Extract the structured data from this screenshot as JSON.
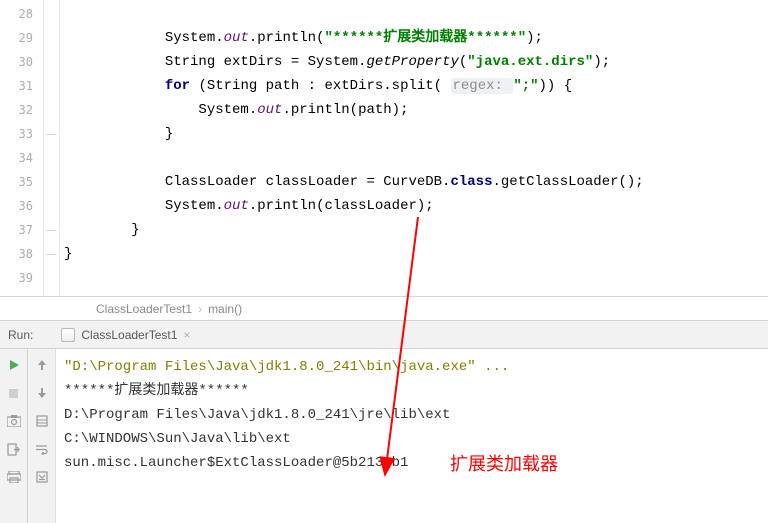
{
  "editor": {
    "lines": [
      {
        "num": 28,
        "fold": "",
        "tokens": []
      },
      {
        "num": 29,
        "fold": "",
        "tokens": [
          {
            "t": "plain",
            "v": "            System."
          },
          {
            "t": "field",
            "v": "out"
          },
          {
            "t": "plain",
            "v": ".println("
          },
          {
            "t": "str",
            "v": "\"******扩展类加载器******\""
          },
          {
            "t": "plain",
            "v": ");"
          }
        ]
      },
      {
        "num": 30,
        "fold": "",
        "tokens": [
          {
            "t": "plain",
            "v": "            String extDirs = System."
          },
          {
            "t": "method-it",
            "v": "getProperty"
          },
          {
            "t": "plain",
            "v": "("
          },
          {
            "t": "str",
            "v": "\"java.ext.dirs\""
          },
          {
            "t": "plain",
            "v": ");"
          }
        ]
      },
      {
        "num": 31,
        "fold": "",
        "tokens": [
          {
            "t": "plain",
            "v": "            "
          },
          {
            "t": "kw",
            "v": "for"
          },
          {
            "t": "plain",
            "v": " (String path : extDirs.split( "
          },
          {
            "t": "hint",
            "v": "regex: "
          },
          {
            "t": "str",
            "v": "\";\""
          },
          {
            "t": "plain",
            "v": ")) {"
          }
        ]
      },
      {
        "num": 32,
        "fold": "",
        "tokens": [
          {
            "t": "plain",
            "v": "                System."
          },
          {
            "t": "field",
            "v": "out"
          },
          {
            "t": "plain",
            "v": ".println(path);"
          }
        ]
      },
      {
        "num": 33,
        "fold": "—",
        "tokens": [
          {
            "t": "plain",
            "v": "            }"
          }
        ]
      },
      {
        "num": 34,
        "fold": "",
        "tokens": []
      },
      {
        "num": 35,
        "fold": "",
        "tokens": [
          {
            "t": "plain",
            "v": "            ClassLoader classLoader = CurveDB."
          },
          {
            "t": "kw",
            "v": "class"
          },
          {
            "t": "plain",
            "v": ".getClassLoader();"
          }
        ]
      },
      {
        "num": 36,
        "fold": "",
        "tokens": [
          {
            "t": "plain",
            "v": "            System."
          },
          {
            "t": "field",
            "v": "out"
          },
          {
            "t": "plain",
            "v": ".println(classLoader);"
          }
        ]
      },
      {
        "num": 37,
        "fold": "—",
        "tokens": [
          {
            "t": "plain",
            "v": "        }"
          }
        ]
      },
      {
        "num": 38,
        "fold": "—",
        "tokens": [
          {
            "t": "plain",
            "v": "}"
          }
        ]
      },
      {
        "num": 39,
        "fold": "",
        "tokens": []
      }
    ]
  },
  "breadcrumb": {
    "item1": "ClassLoaderTest1",
    "item2": "main()"
  },
  "run": {
    "label": "Run:",
    "config": "ClassLoaderTest1",
    "console": {
      "cmd": "\"D:\\Program Files\\Java\\jdk1.8.0_241\\bin\\java.exe\" ...",
      "l2": "******扩展类加载器******",
      "l3": "D:\\Program Files\\Java\\jdk1.8.0_241\\jre\\lib\\ext",
      "l4": "C:\\WINDOWS\\Sun\\Java\\lib\\ext",
      "l5": "sun.misc.Launcher$ExtClassLoader@5b2133b1"
    },
    "annotation": "扩展类加载器"
  }
}
